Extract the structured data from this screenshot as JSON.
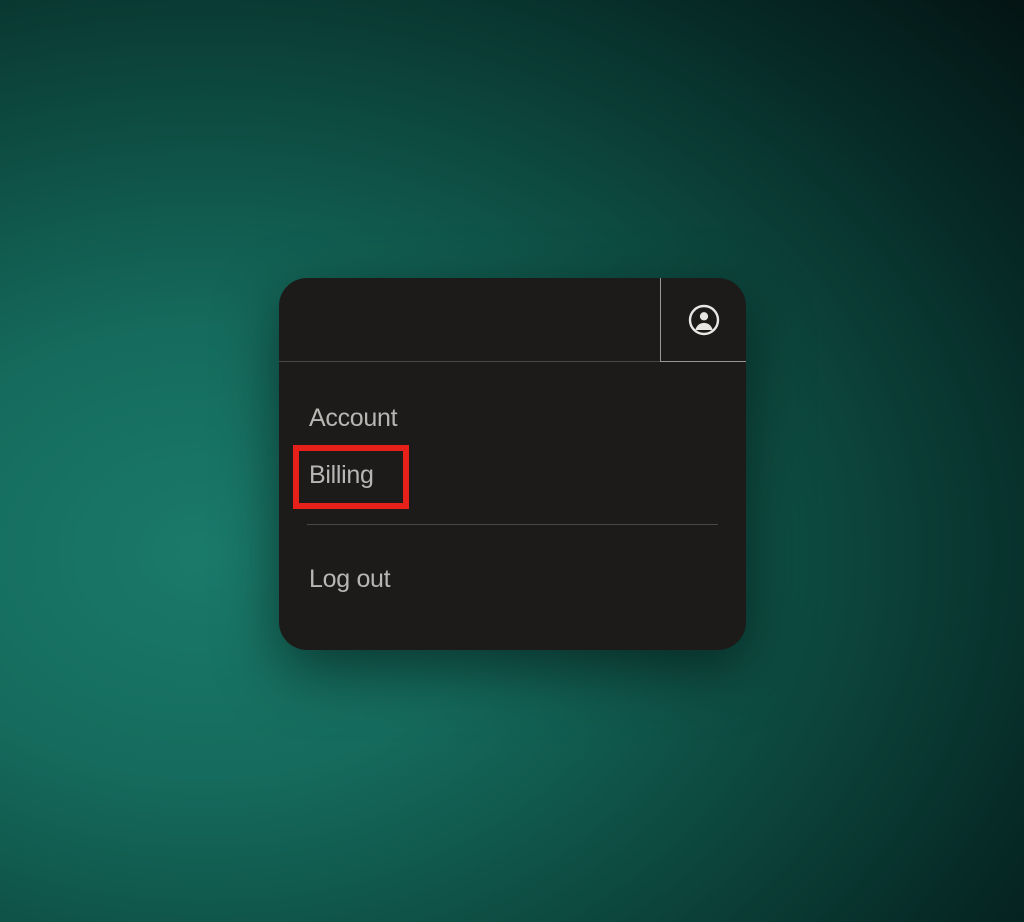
{
  "menu": {
    "items": [
      {
        "label": "Account"
      },
      {
        "label": "Billing"
      }
    ],
    "logout": "Log out"
  }
}
